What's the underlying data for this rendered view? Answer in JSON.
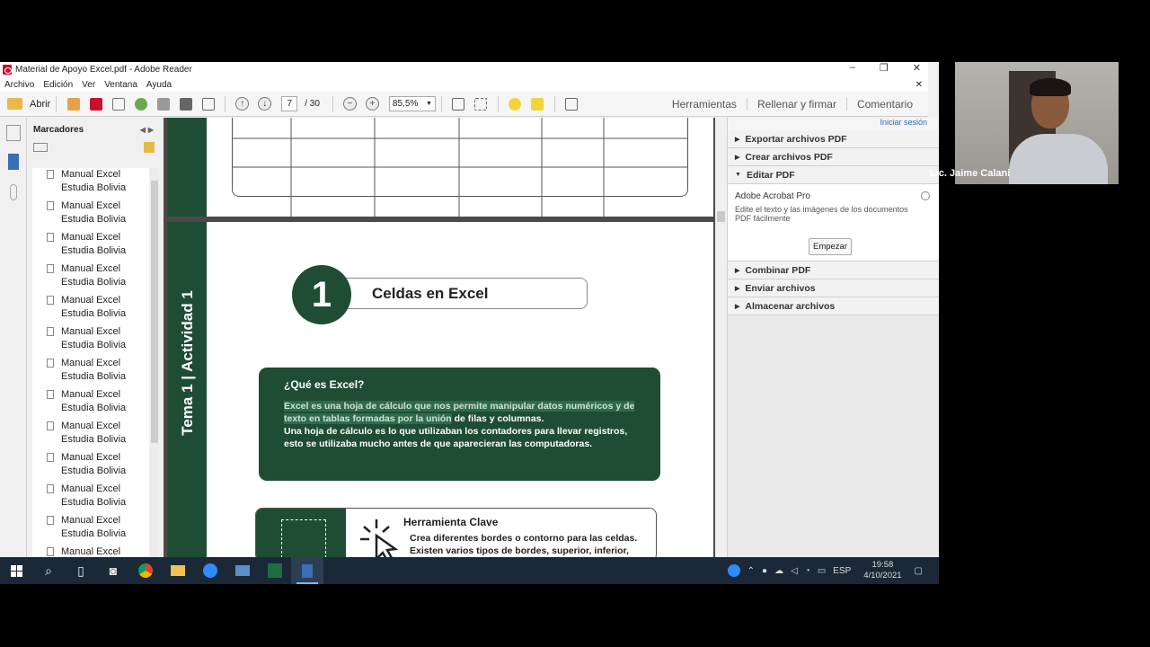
{
  "window": {
    "title": "Material de Apoyo Excel.pdf - Adobe Reader",
    "minimize": "–",
    "restore": "❐",
    "close": "✕"
  },
  "menu": {
    "items": [
      "Archivo",
      "Edición",
      "Ver",
      "Ventana",
      "Ayuda"
    ],
    "close": "✕"
  },
  "toolbar": {
    "open_label": "Abrir",
    "page_current": "7",
    "page_total": "/ 30",
    "zoom": "85,5%",
    "right": [
      "Herramientas",
      "Rellenar y firmar",
      "Comentario"
    ]
  },
  "bookmarks": {
    "title": "Marcadores",
    "items": [
      {
        "line1": "Manual Excel",
        "line2": "Estudia Bolivia"
      },
      {
        "line1": "Manual Excel",
        "line2": "Estudia Bolivia"
      },
      {
        "line1": "Manual Excel",
        "line2": "Estudia Bolivia"
      },
      {
        "line1": "Manual Excel",
        "line2": "Estudia Bolivia"
      },
      {
        "line1": "Manual Excel",
        "line2": "Estudia Bolivia"
      },
      {
        "line1": "Manual Excel",
        "line2": "Estudia Bolivia"
      },
      {
        "line1": "Manual Excel",
        "line2": "Estudia Bolivia"
      },
      {
        "line1": "Manual Excel",
        "line2": "Estudia Bolivia"
      },
      {
        "line1": "Manual Excel",
        "line2": "Estudia Bolivia"
      },
      {
        "line1": "Manual Excel",
        "line2": "Estudia Bolivia"
      },
      {
        "line1": "Manual Excel",
        "line2": "Estudia Bolivia"
      },
      {
        "line1": "Manual Excel",
        "line2": "Estudia Bolivia"
      },
      {
        "line1": "Manual Excel",
        "line2": ""
      }
    ]
  },
  "document": {
    "side_title": "Tema 1 | Actividad 1",
    "number": "1",
    "section_title": "Celdas en Excel",
    "box_heading": "¿Qué es Excel?",
    "box_text_1": "Excel es una hoja de cálculo que nos permite manipular datos numéricos y de texto en tablas formadas por la unión",
    "box_text_2": "de filas y columnas.",
    "box_text_3": "Una hoja de cálculo es lo que utilizaban los contadores para llevar registros, esto se utilizaba mucho antes de que aparecieran las computadoras.",
    "tool_heading": "Herramienta Clave",
    "tool_text": "Crea diferentes bordes o contorno para las celdas. Existen varios tipos de bordes, superior, inferior,"
  },
  "right_panel": {
    "login": "Iniciar sesión",
    "sections_top": [
      "Exportar archivos PDF",
      "Crear archivos PDF",
      "Editar PDF"
    ],
    "edit_title": "Adobe Acrobat Pro",
    "edit_desc": "Edite el texto y las imágenes de los documentos PDF fácilmente",
    "edit_button": "Empezar",
    "sections_bottom": [
      "Combinar PDF",
      "Enviar archivos",
      "Almacenar archivos"
    ]
  },
  "taskbar": {
    "lang": "ESP",
    "time": "19:58",
    "date": "4/10/2021"
  },
  "webcam": {
    "name": "Lic. Jaime Calani"
  },
  "colors": {
    "doc_green": "#1f4d34",
    "link_blue": "#2a6bb5",
    "taskbar": "#1b2838"
  }
}
